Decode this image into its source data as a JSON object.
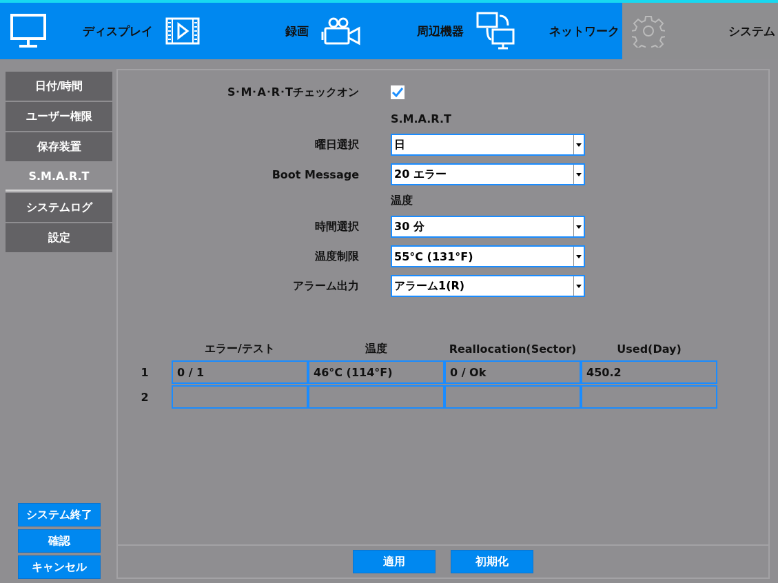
{
  "top_tabs": [
    {
      "label": "ディスプレイ",
      "selected": false
    },
    {
      "label": "録画",
      "selected": false
    },
    {
      "label": "周辺機器",
      "selected": false
    },
    {
      "label": "ネットワーク",
      "selected": false
    },
    {
      "label": "システム",
      "selected": true
    }
  ],
  "sidebar": {
    "items": [
      {
        "label": "日付/時間",
        "selected": false
      },
      {
        "label": "ユーザー権限",
        "selected": false
      },
      {
        "label": "保存装置",
        "selected": false
      },
      {
        "label": "S.M.A.R.T",
        "selected": true
      },
      {
        "label": "システムログ",
        "selected": false
      },
      {
        "label": "設定",
        "selected": false
      }
    ],
    "buttons": [
      "システム終了",
      "確認",
      "キャンセル"
    ]
  },
  "form": [
    {
      "kind": "checkbox",
      "label": "S･M･A･R･Tチェックオン",
      "checked": true
    },
    {
      "kind": "heading",
      "label": "S.M.A.R.T"
    },
    {
      "kind": "select",
      "label": "曜日選択",
      "value": "日"
    },
    {
      "kind": "select",
      "label": "Boot Message",
      "value": "20 エラー"
    },
    {
      "kind": "heading",
      "label": "温度"
    },
    {
      "kind": "select",
      "label": "時間選択",
      "value": "30 分"
    },
    {
      "kind": "select",
      "label": "温度制限",
      "value": "55°C (131°F)"
    },
    {
      "kind": "select",
      "label": "アラーム出力",
      "value": "アラーム1(R)"
    }
  ],
  "table": {
    "columns": [
      "エラー/テスト",
      "温度",
      "Reallocation(Sector)",
      "Used(Day)"
    ],
    "rows": [
      {
        "index": "1",
        "cells": [
          "0 / 1",
          "46°C (114°F)",
          "0 / Ok",
          "450.2"
        ]
      },
      {
        "index": "2",
        "cells": [
          "",
          "",
          "",
          ""
        ]
      }
    ]
  },
  "footer_buttons": [
    "適用",
    "初期化"
  ]
}
